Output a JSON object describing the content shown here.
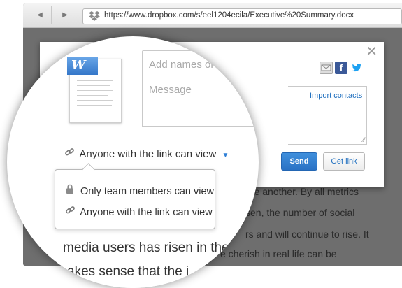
{
  "browser": {
    "url": "https://www.dropbox.com/s/eel1204ecila/Executive%20Summary.docx",
    "back_icon": "back-arrow-icon",
    "forward_icon": "forward-arrow-icon"
  },
  "background_text": {
    "line1": "one another. By all metrics",
    "line2": "sen, the number of social",
    "line3": "rs and will continue to rise. It",
    "line4": "e cherish in real life can be"
  },
  "dialog": {
    "close_label": "✕",
    "import_contacts": "Import contacts",
    "send_label": "Send",
    "get_link_label": "Get link"
  },
  "magnifier": {
    "file_badge": "W",
    "names_placeholder": "Add names or em",
    "message_placeholder": "Message",
    "permission_label": "Anyone with the link can view",
    "dropdown": {
      "item1": "Only team members can view",
      "item2": "Anyone with the link can view"
    },
    "text_line1": "media users has risen in the",
    "text_line2": "akes sense that the i"
  },
  "colors": {
    "accent": "#2f7fd6",
    "send_button": "#2a72c5",
    "facebook": "#3b5998",
    "twitter": "#1da1f2",
    "page_bg": "#6e6e6e"
  }
}
